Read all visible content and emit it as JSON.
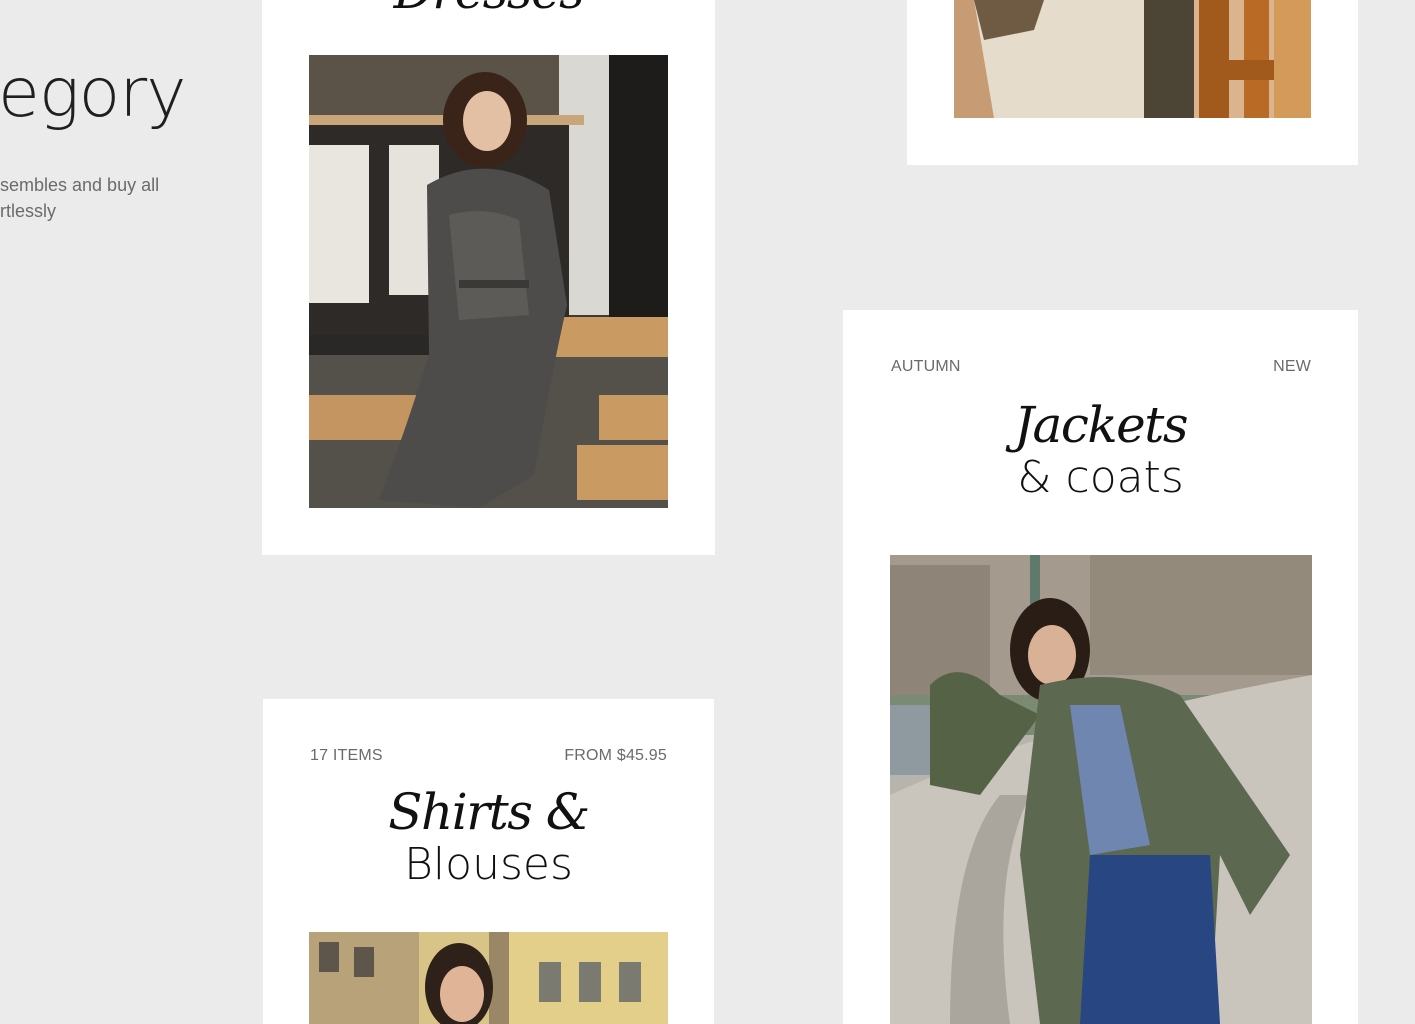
{
  "hero": {
    "title": "egory",
    "description": "sembles and buy all rtlessly"
  },
  "cards": {
    "dresses": {
      "title_serif": "Dresses",
      "image_label": "woman in grey denim shirt dress sitting on wooden bench"
    },
    "top_right": {
      "image_label": "close-up of skirt and wooden chair"
    },
    "jackets": {
      "left_meta": "AUTUMN",
      "right_meta": "NEW",
      "title_serif": "Jackets",
      "title_sans": "& coats",
      "image_label": "woman in olive jacket leaning on stone bridge"
    },
    "shirts": {
      "left_meta": "17 ITEMS",
      "right_meta": "FROM $45.95",
      "title_serif": "Shirts &",
      "title_sans": "Blouses",
      "image_label": "woman smiling on city street"
    }
  },
  "colors": {
    "background": "#ebebeb",
    "card": "#ffffff",
    "text_dark": "#111111",
    "text_meta": "#6a6a6a"
  }
}
